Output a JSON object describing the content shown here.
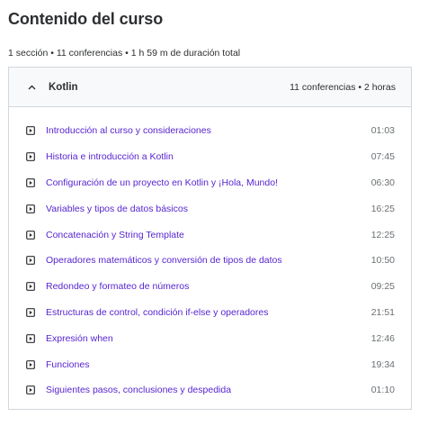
{
  "course": {
    "title": "Contenido del curso",
    "summary": "1 sección • 11 conferencias • 1 h 59 m de duración total"
  },
  "section": {
    "name": "Kotlin",
    "meta": "11 conferencias • 2 horas",
    "expanded": true,
    "lectures": [
      {
        "title": "Introducción al curso y consideraciones",
        "duration": "01:03"
      },
      {
        "title": "Historia e introducción a Kotlin",
        "duration": "07:45"
      },
      {
        "title": "Configuración de un proyecto en Kotlin y ¡Hola, Mundo!",
        "duration": "06:30"
      },
      {
        "title": "Variables y tipos de datos básicos",
        "duration": "16:25"
      },
      {
        "title": "Concatenación y String Template",
        "duration": "12:25"
      },
      {
        "title": "Operadores matemáticos y conversión de tipos de datos",
        "duration": "10:50"
      },
      {
        "title": "Redondeo y formateo de números",
        "duration": "09:25"
      },
      {
        "title": "Estructuras de control, condición if-else y operadores",
        "duration": "21:51"
      },
      {
        "title": "Expresión when",
        "duration": "12:46"
      },
      {
        "title": "Funciones",
        "duration": "19:34"
      },
      {
        "title": "Siguientes pasos, conclusiones y despedida",
        "duration": "01:10"
      }
    ]
  },
  "icons": {
    "chevron": "chevron-up-icon",
    "lecture": "video-play-icon"
  },
  "colors": {
    "link": "#5624d0",
    "text": "#2d2f31",
    "muted": "#6a6f73",
    "header_bg": "#f7f9fa",
    "border": "#d1d7dc"
  }
}
